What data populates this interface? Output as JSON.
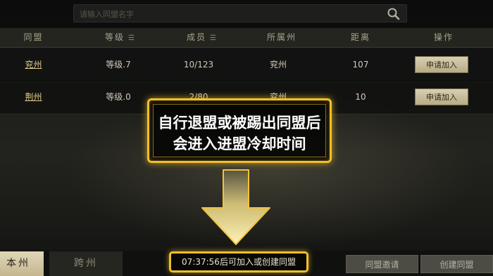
{
  "search": {
    "placeholder": "请输入同盟名字"
  },
  "table": {
    "headers": [
      "同盟",
      "等级",
      "成员",
      "所属州",
      "距离",
      "操作"
    ],
    "sort_icon": "☰",
    "rows": [
      {
        "name": "兖州",
        "level": "等级.7",
        "members": "10/123",
        "state": "兖州",
        "distance": "107",
        "action": "申请加入"
      },
      {
        "name": "荆州",
        "level": "等级.0",
        "members": "2/80",
        "state": "兖州",
        "distance": "10",
        "action": "申请加入"
      }
    ]
  },
  "tooltip": {
    "line1": "自行退盟或被踢出同盟后",
    "line2": "会进入进盟冷却时间"
  },
  "bottom": {
    "tab_home": "本州",
    "tab_cross": "跨州",
    "cooldown": "07:37:56后可加入或创建同盟",
    "invite_button": "同盟邀请",
    "create_button": "创建同盟"
  },
  "colors": {
    "highlight": "#f0c02a",
    "button_bg": "#d9cfb0",
    "link": "#e3c98a"
  },
  "icons": {
    "search": "search-icon",
    "sort": "sort-icon",
    "arrow": "arrow-down-icon"
  }
}
